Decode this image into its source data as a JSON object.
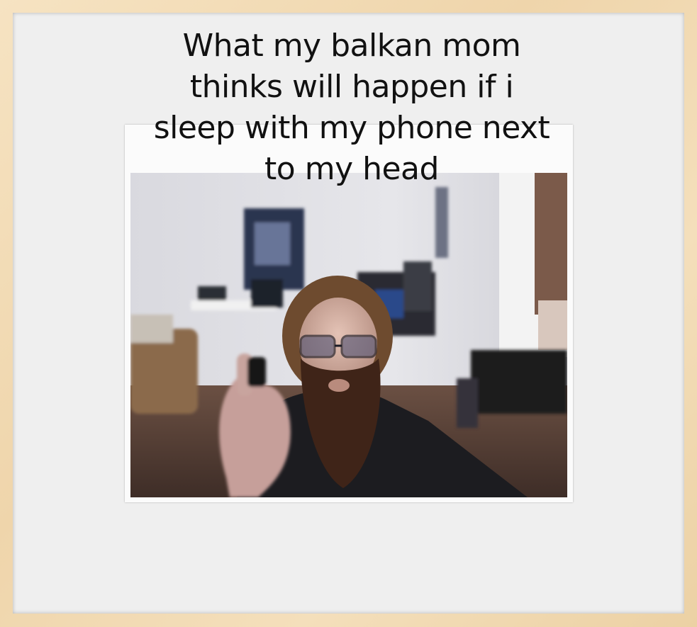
{
  "meme": {
    "caption": "What my balkan mom\nthinks will happen if i\nsleep with my phone next\nto my head"
  },
  "colors": {
    "frame": "#f3dfbd",
    "mat": "#efefef",
    "caption_text": "#111111"
  }
}
